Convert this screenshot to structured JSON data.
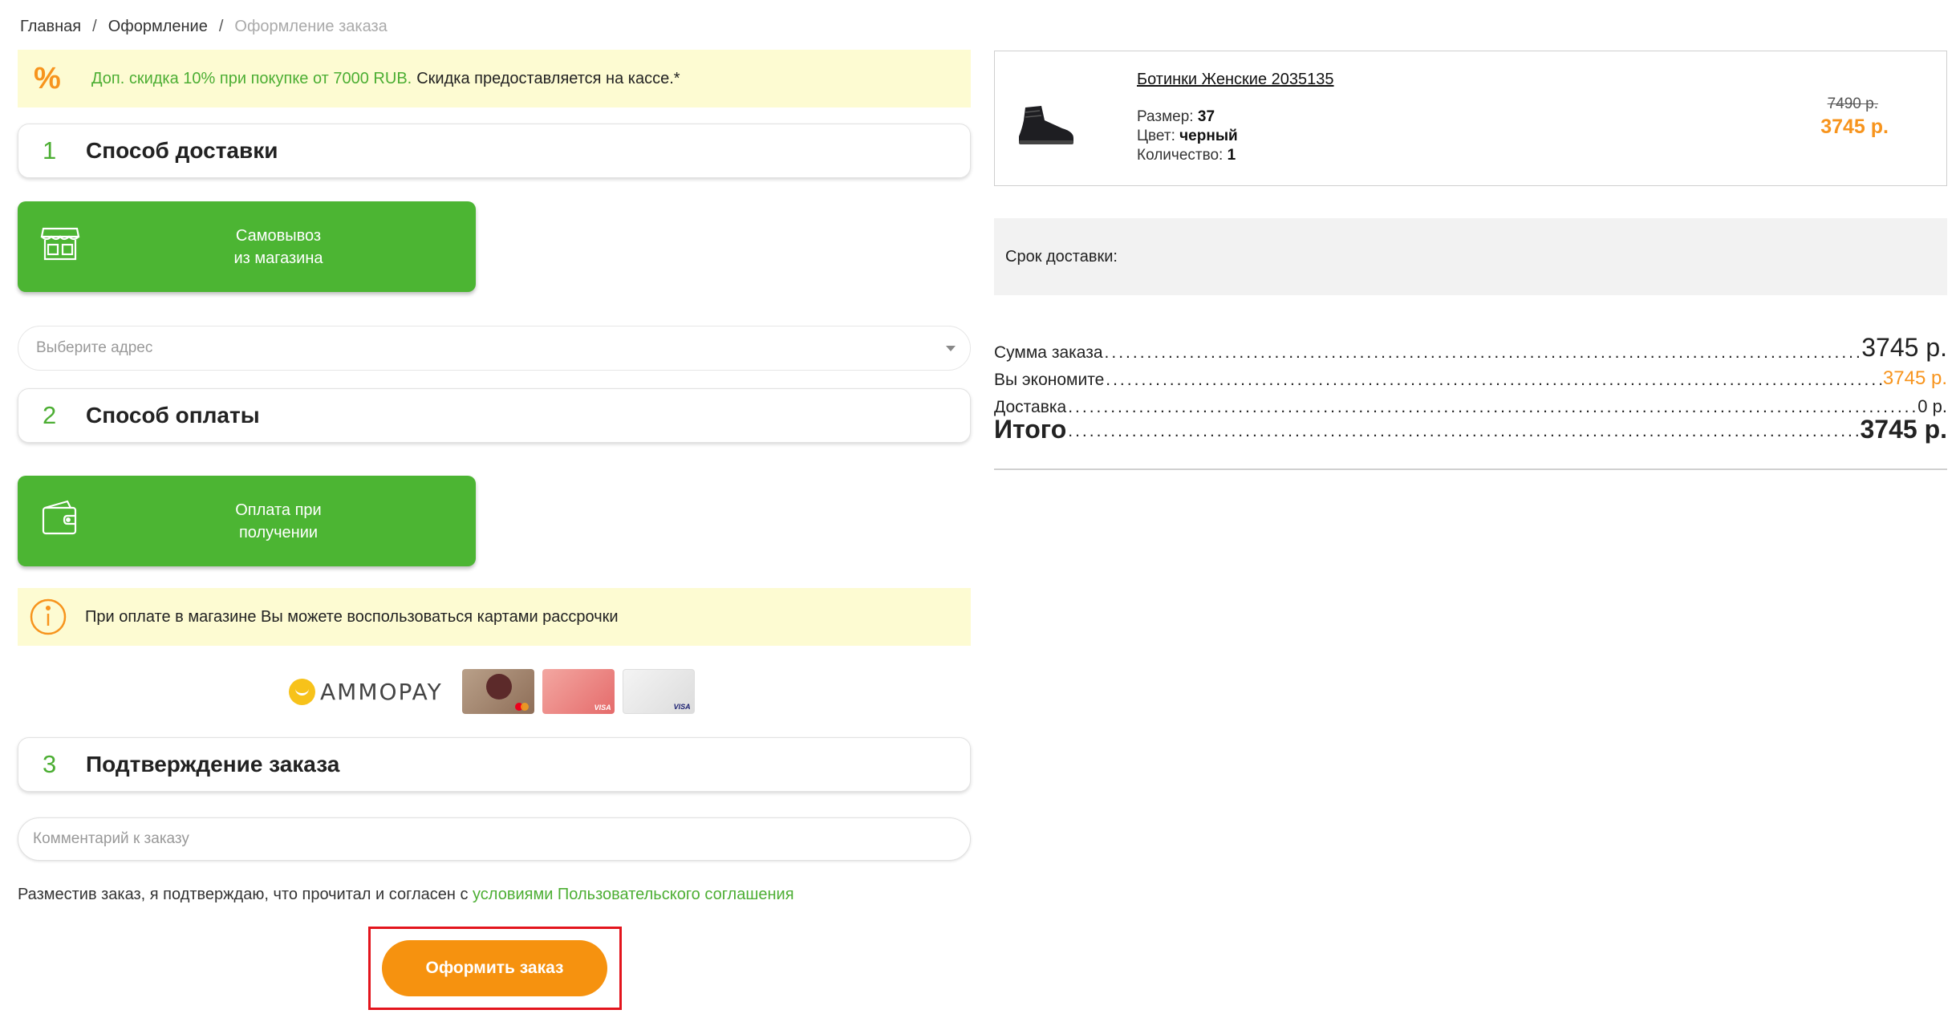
{
  "breadcrumb": {
    "items": [
      "Главная",
      "Оформление",
      "Оформление заказа"
    ],
    "separator": "/"
  },
  "promo": {
    "icon": "percent-icon",
    "icon_glyph": "%",
    "highlight": "Доп. скидка 10% при покупке от 7000 RUB.",
    "text": "Скидка предоставляется на кассе.*"
  },
  "steps": [
    {
      "number": "1",
      "title": "Способ доставки"
    },
    {
      "number": "2",
      "title": "Способ оплаты"
    },
    {
      "number": "3",
      "title": "Подтверждение заказа"
    }
  ],
  "delivery_option": {
    "icon": "store-icon",
    "line1": "Самовывоз",
    "line2": "из магазина"
  },
  "address_select": {
    "placeholder": "Выберите адрес"
  },
  "payment_option": {
    "icon": "wallet-icon",
    "line1": "Оплата при",
    "line2": "получении"
  },
  "installment_notice": {
    "icon": "info-icon",
    "text": "При оплате в магазине Вы можете воспользоваться картами рассрочки"
  },
  "installment_logos": {
    "ammopay": "AMMOPAY",
    "cards": [
      "installment-card-1",
      "installment-card-2",
      "installment-card-3"
    ],
    "card_brand_labels": [
      "VISA",
      "VISA"
    ]
  },
  "comment": {
    "placeholder": "Комментарий к заказу"
  },
  "agreement": {
    "text": "Разместив заказ, я подтверждаю, что прочитал и согласен с",
    "link": "условиями Пользовательского соглашения"
  },
  "submit": {
    "label": "Оформить заказ"
  },
  "product": {
    "name": "Ботинки Женские 2035135",
    "size_label": "Размер:",
    "size": "37",
    "color_label": "Цвет:",
    "color": "черный",
    "qty_label": "Количество:",
    "qty": "1",
    "old_price": "7490 р.",
    "price": "3745 р."
  },
  "delivery_term": {
    "label": "Срок доставки:"
  },
  "totals": {
    "sum_label": "Сумма заказа",
    "sum": "3745 р.",
    "save_label": "Вы экономите",
    "save": "3745 р.",
    "delivery_label": "Доставка",
    "delivery": "0 р.",
    "total_label": "Итого",
    "total": "3745 р."
  },
  "colors": {
    "green": "#4cb533",
    "orange": "#f7941d",
    "notice_bg": "#fdfbd2",
    "highlight_border": "#e3141c"
  }
}
